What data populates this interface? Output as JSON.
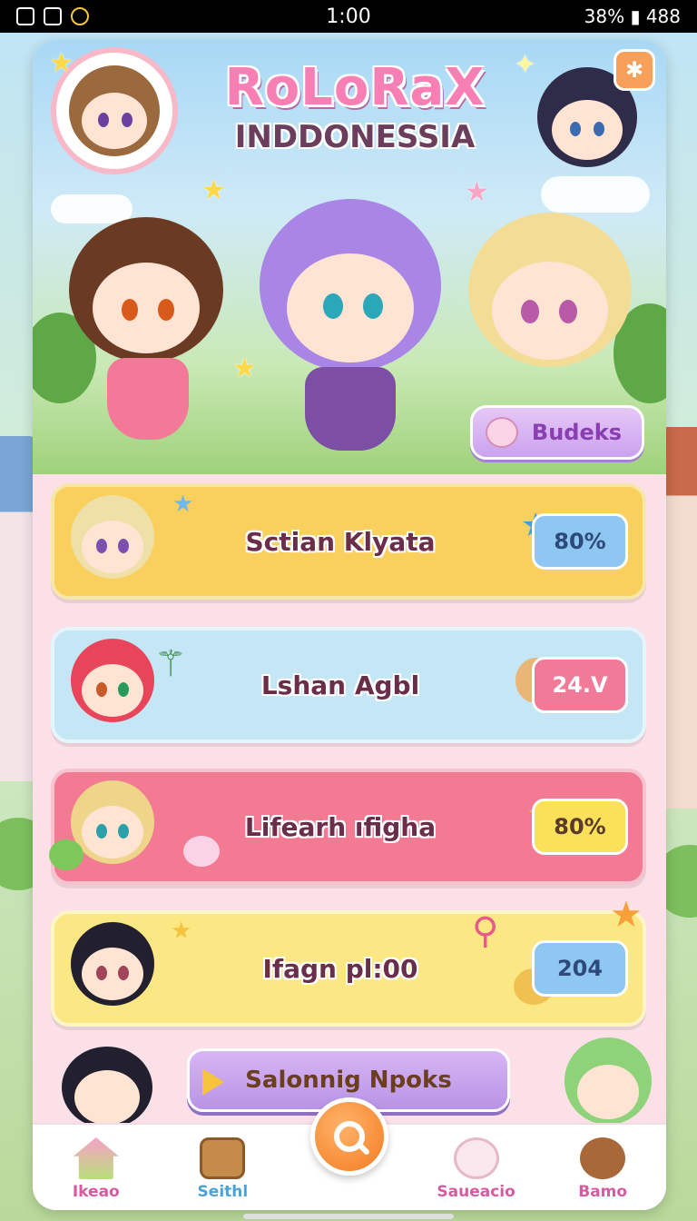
{
  "status_bar": {
    "time": "1:00",
    "right": "38% ▮ 488"
  },
  "header": {
    "logo_title": "RoLoRaX",
    "logo_subtitle": "INDDONESSIA",
    "settings_icon": "settings-icon",
    "budeks_label": "Budeks"
  },
  "list": {
    "rows": [
      {
        "title": "Sctian Klyata",
        "badge": "80%",
        "color": "#f9cf5e"
      },
      {
        "title": "Lshan Agbl",
        "badge": "24.V",
        "color": "#c5e6f5"
      },
      {
        "title": "Lifearh ıfigha",
        "badge": "80%",
        "color": "#f27b93"
      },
      {
        "title": "Ifagn pl:00",
        "badge": "204",
        "color": "#fbe884"
      }
    ]
  },
  "cta": {
    "label": "Salonnig Npoks"
  },
  "bottom_nav": {
    "items": [
      {
        "label": "Ikeao",
        "icon": "home-icon",
        "color": "#d85aa0"
      },
      {
        "label": "Seithl",
        "icon": "chest-icon",
        "color": "#4aa3d8"
      },
      {
        "label": "",
        "icon": "search-icon",
        "color": "#f37b1f"
      },
      {
        "label": "Saueacio",
        "icon": "bunny-icon",
        "color": "#d85aa0"
      },
      {
        "label": "Bamo",
        "icon": "bear-icon",
        "color": "#d85aa0"
      }
    ]
  }
}
